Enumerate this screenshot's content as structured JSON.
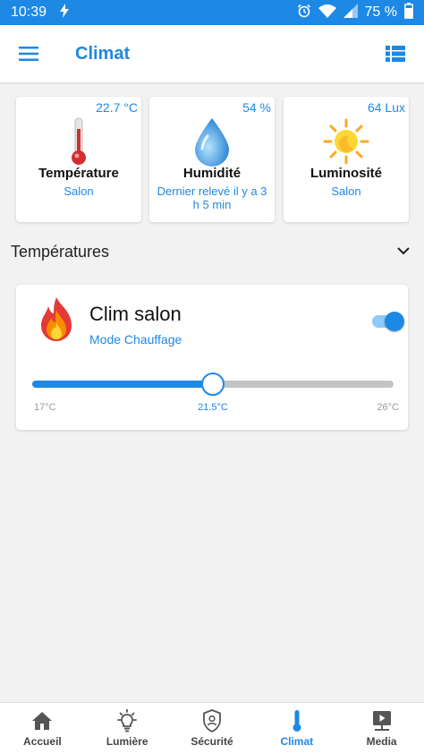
{
  "status_bar": {
    "time": "10:39",
    "battery": "75 %"
  },
  "app_bar": {
    "title": "Climat"
  },
  "sensors": [
    {
      "value": "22.7 °C",
      "name": "Température",
      "sub": "Salon",
      "icon": "thermometer-icon"
    },
    {
      "value": "54 %",
      "name": "Humidité",
      "sub": "Dernier relevé il y a 3 h 5 min",
      "icon": "water-drop-icon"
    },
    {
      "value": "64 Lux",
      "name": "Luminosité",
      "sub": "Salon",
      "icon": "sun-icon"
    }
  ],
  "section": {
    "label": "Températures"
  },
  "clim": {
    "title": "Clim salon",
    "mode": "Mode Chauffage",
    "enabled": true,
    "slider": {
      "min": 17,
      "max": 26,
      "value": 21.5,
      "min_label": "17°C",
      "max_label": "26°C",
      "value_label": "21.5°C"
    }
  },
  "bottom_nav": [
    {
      "label": "Accueil",
      "icon": "home-icon",
      "active": false
    },
    {
      "label": "Lumière",
      "icon": "lightbulb-icon",
      "active": false
    },
    {
      "label": "Sécurité",
      "icon": "shield-icon",
      "active": false
    },
    {
      "label": "Climat",
      "icon": "thermometer-icon",
      "active": true
    },
    {
      "label": "Media",
      "icon": "media-icon",
      "active": false
    }
  ],
  "colors": {
    "accent": "#1e88e5",
    "accent_light": "#90caf9",
    "background": "#f2f2f2"
  }
}
